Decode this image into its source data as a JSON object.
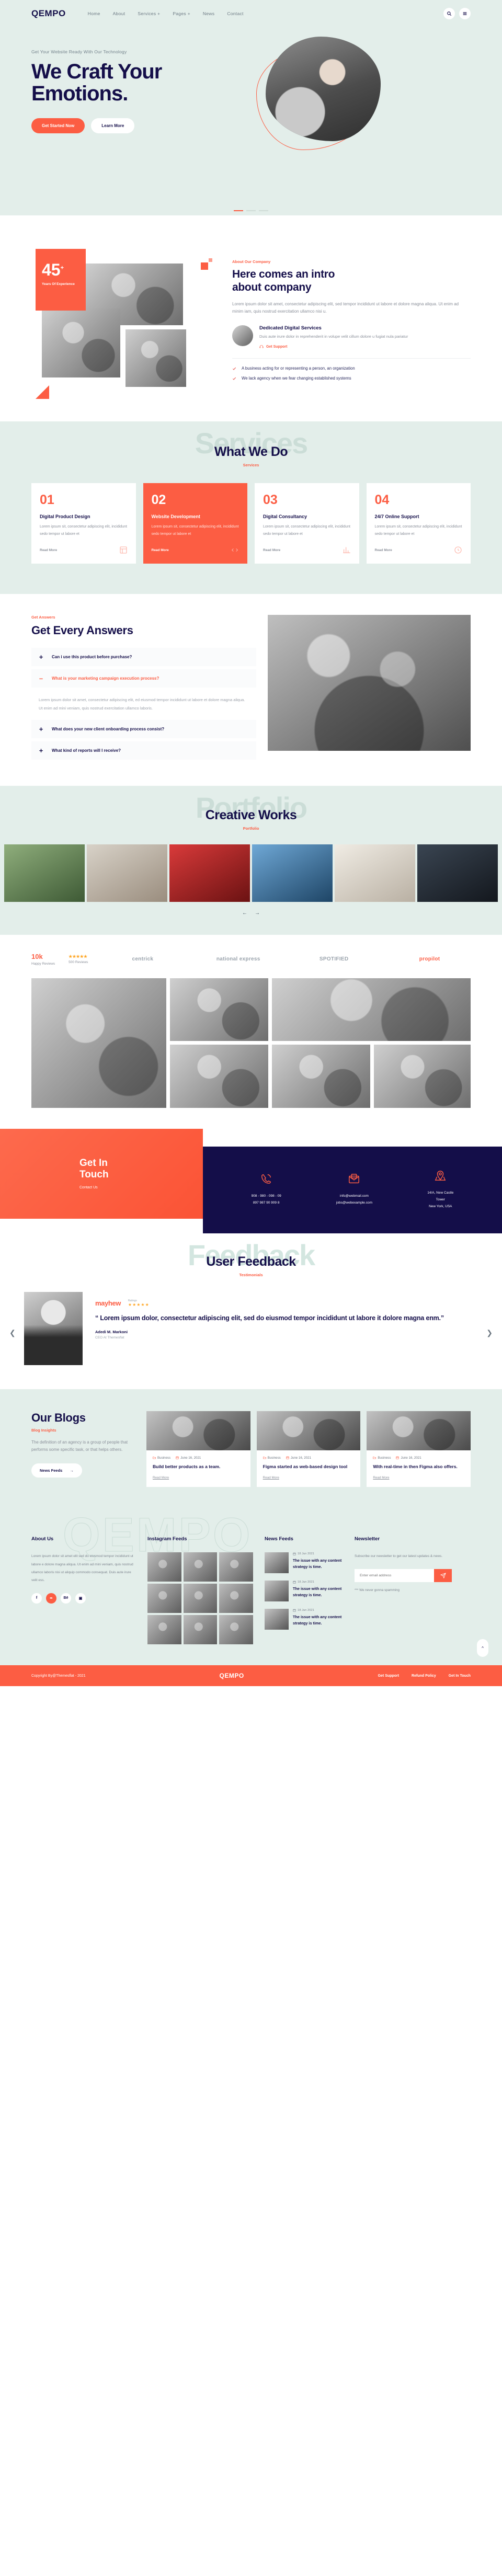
{
  "brand": {
    "name": "QEMPO",
    "accent": "#fc5d43",
    "navy": "#140e49",
    "mint": "#e3eeea"
  },
  "nav": {
    "items": [
      {
        "label": "Home"
      },
      {
        "label": "About"
      },
      {
        "label": "Services +"
      },
      {
        "label": "Pages +"
      },
      {
        "label": "News"
      },
      {
        "label": "Contact"
      }
    ],
    "search_icon": "search-icon",
    "menu_icon": "hamburger-icon"
  },
  "hero": {
    "subtitle": "Get Your Website Ready With Our Technology",
    "title_line1": "We Craft Your",
    "title_line2": "Emotions.",
    "primary_button": "Get Started Now",
    "secondary_button": "Learn More"
  },
  "about": {
    "stat_number": "45",
    "stat_plus": "+",
    "stat_label": "Years Of Experience",
    "eyebrow": "About Our Company",
    "title_line1": "Here comes an intro",
    "title_line2": "about company",
    "paragraph": "Lorem ipsum dolor sit amet, consectetur adipiscing elit, sed tempor incididunt ut labore et dolore magna aliqua. Ut enim ad minim iam, quis nostrud exercitation ullamco nisi u.",
    "service_title": "Dedicated Digital Services",
    "service_text": "Duis aute irure dolor in reprehenderit in volupe velit cillum dolore u fugiat nula pariatur",
    "service_link": "Get Support",
    "checks": [
      "A business acting for or representing a person, an organization",
      "We lack agency when we fear changing established systems"
    ]
  },
  "services": {
    "ghost": "Services",
    "title": "What We Do",
    "eyebrow": "Services",
    "read_more": "Read More",
    "cards": [
      {
        "num": "01",
        "title": "Digital Product Design",
        "text": "Lorem ipsum sit, consectetur adipiscing elit, incididunt sedo tempor ut labore et",
        "active": false
      },
      {
        "num": "02",
        "title": "Website Development",
        "text": "Lorem ipsum sit, consectetur adipiscing elit, incididunt sedo tempor ut labore et",
        "active": true
      },
      {
        "num": "03",
        "title": "Digital Consultancy",
        "text": "Lorem ipsum sit, consectetur adipiscing elit, incididunt sedo tempor ut labore et",
        "active": false
      },
      {
        "num": "04",
        "title": "24/7 Online Support",
        "text": "Lorem ipsum sit, consectetur adipiscing elit, incididunt sedo tempor ut labore et",
        "active": false
      }
    ]
  },
  "faq": {
    "eyebrow": "Get Answers",
    "title": "Get Every Answers",
    "answer_text": "Lorem ipsum dolor sit amet, consectetur adipiscing elit, ed eiusmod tempor incididunt ut labore et dolore magna aliqua. Ut enim ad mini veniam, quis nostrud exercitation ullamco laboris.",
    "items": [
      {
        "q": "Can i use this product before purchase?",
        "open": false,
        "sign": "+"
      },
      {
        "q": "What is your marketing campaign execution process?",
        "open": true,
        "sign": "–"
      },
      {
        "q": "What does your new client onboarding process consist?",
        "open": false,
        "sign": "+"
      },
      {
        "q": "What kind of reports will I receive?",
        "open": false,
        "sign": "+"
      }
    ]
  },
  "portfolio": {
    "ghost": "Portfolio",
    "title": "Creative Works",
    "eyebrow": "Portfolio",
    "prev_icon": "arrow-left-icon",
    "next_icon": "arrow-right-icon",
    "items_count": 6
  },
  "clients": {
    "happy_number": "10k",
    "happy_label": "Happy Reviews",
    "rated_label": "500 Reviews",
    "brands": [
      "centrick",
      "national express",
      "SPOTIFIED",
      "propilot"
    ]
  },
  "contact": {
    "title_line1": "Get In",
    "title_line2": "Touch",
    "subtitle": "Contact Us",
    "cells": [
      {
        "icon": "phone-icon",
        "lines": [
          "908 - 980 - 098 - 09",
          "897 987 90 909 8"
        ]
      },
      {
        "icon": "mail-icon",
        "lines": [
          "info@webmail.com",
          "jobs@webexample.com"
        ]
      },
      {
        "icon": "location-icon",
        "lines": [
          "14/A, New Castle",
          "Tower",
          "New York, USA"
        ]
      }
    ]
  },
  "testimonial": {
    "ghost": "Feedback",
    "title": "User Feedback",
    "eyebrow": "Testimonials",
    "brand": "mayhew",
    "ratings_label": "Ratings",
    "stars": "★★★★★",
    "quote": "“ Lorem ipsum dolor, consectetur adipiscing elit, sed do eiusmod tempor incididunt ut labore it dolore magna enm.”",
    "name": "Adedi M. Markoni",
    "role": "CEO At Themesflat",
    "prev_icon": "chevron-left-icon",
    "next_icon": "chevron-right-icon"
  },
  "blog": {
    "title": "Our Blogs",
    "eyebrow": "Blog Insights",
    "paragraph": "The definition of an agency is a group of people that performs some specific task, or that helps others.",
    "button": "News Feeds",
    "read_more": "Read More",
    "posts": [
      {
        "category": "Business",
        "date": "June 16, 2021",
        "title": "Build better products as a team."
      },
      {
        "category": "Business",
        "date": "June 16, 2021",
        "title": "Figma started as web-based design tool"
      },
      {
        "category": "Business",
        "date": "June 16, 2021",
        "title": "With real-time in then Figma also offers."
      }
    ]
  },
  "footer": {
    "ghost": "QEMPO",
    "about": {
      "heading": "About Us",
      "text": "Lorem ipsum dolor sit amet elit sed do eiusmod tempor incididunt ut labore e dolore magna aliqua. Ut enim ad mini veniam, quis nostrud  ullamco laboris nisi ut aliquip commodo consequat. Duis aute irure velit ess.",
      "socials": [
        {
          "icon": "facebook-icon",
          "glyph": "f",
          "active": false
        },
        {
          "icon": "twitter-icon",
          "glyph": "✒",
          "active": true
        },
        {
          "icon": "behance-icon",
          "glyph": "Bē",
          "active": false
        },
        {
          "icon": "instagram-icon",
          "glyph": "▣",
          "active": false
        }
      ]
    },
    "instagram": {
      "heading": "Instagram Feeds",
      "count": 9
    },
    "news": {
      "heading": "News Feeds",
      "items": [
        {
          "date": "18 Jun 2021",
          "title": "The issue with any content strategy is time."
        },
        {
          "date": "18 Jun 2021",
          "title": "The issue with any content strategy is time."
        },
        {
          "date": "18 Jun 2021",
          "title": "The issue with any content strategy is time."
        }
      ]
    },
    "newsletter": {
      "heading": "Newsletter",
      "text": "Subscribe our newsletter to get our latest updates & news.",
      "placeholder": "Enter email address",
      "send_icon": "send-icon",
      "note": "*** We never gonna spamming"
    },
    "to_top_icon": "chevron-up-icon"
  },
  "copybar": {
    "copyright": "Copyright By@Themesflat - 2021",
    "logo": "QEMPO",
    "links": [
      "Get Support",
      "Refund Policy",
      "Get In Touch"
    ]
  }
}
